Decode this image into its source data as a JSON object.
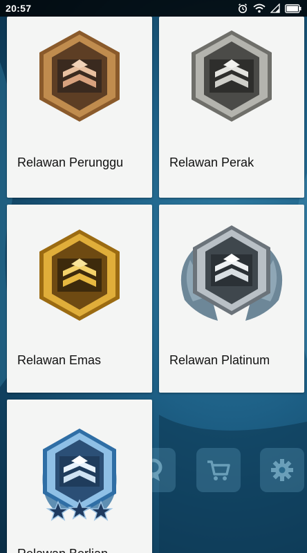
{
  "status_bar": {
    "time": "20:57",
    "icons": [
      "alarm-icon",
      "wifi-icon",
      "signal-icon",
      "battery-icon"
    ]
  },
  "cards": [
    {
      "label": "Relawan Perunggu",
      "badge": "bronze-badge-icon",
      "color": "#b07a3c"
    },
    {
      "label": "Relawan Perak",
      "badge": "silver-badge-icon",
      "color": "#a9a9a4"
    },
    {
      "label": "Relawan Emas",
      "badge": "gold-badge-icon",
      "color": "#d3a12b"
    },
    {
      "label": "Relawan Platinum",
      "badge": "platinum-badge-icon",
      "color": "#9aa3ab"
    },
    {
      "label": "Relawan Berlian",
      "badge": "diamond-badge-icon",
      "color": "#4f8fc6"
    }
  ],
  "dock": {
    "buttons": [
      "achievement-icon",
      "cart-icon",
      "settings-icon"
    ]
  }
}
